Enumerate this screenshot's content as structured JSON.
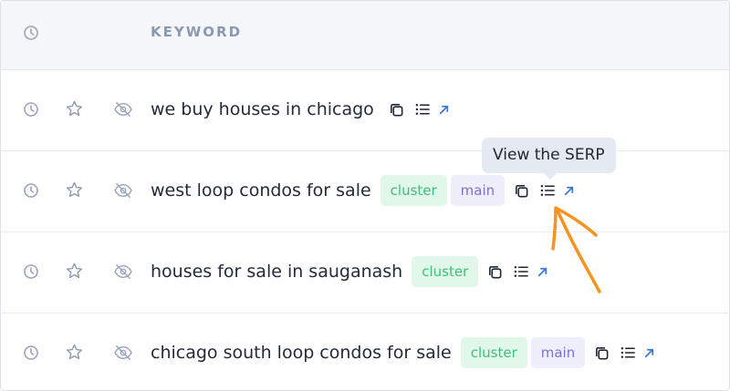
{
  "header": {
    "history_icon": "clock-icon",
    "keyword_label": "KEYWORD"
  },
  "rows": [
    {
      "keyword": "we buy houses in chicago",
      "tags": []
    },
    {
      "keyword": "west loop condos for sale",
      "tags": [
        "cluster",
        "main"
      ]
    },
    {
      "keyword": "houses for sale in sauganash",
      "tags": [
        "cluster"
      ]
    },
    {
      "keyword": "chicago south loop condos for sale",
      "tags": [
        "cluster",
        "main"
      ]
    }
  ],
  "row_icons": [
    "clock-icon",
    "star-icon",
    "eye-off-icon"
  ],
  "row_actions": [
    "copy-icon",
    "list-icon",
    "external-link-icon"
  ],
  "tooltip": {
    "text": "View the SERP"
  },
  "colors": {
    "accent_link": "#3b78d8",
    "cluster_bg": "#e1f7ea",
    "cluster_text": "#3fbf7a",
    "main_bg": "#efeefb",
    "main_text": "#7b6fd6",
    "annotation": "#f7931e"
  }
}
